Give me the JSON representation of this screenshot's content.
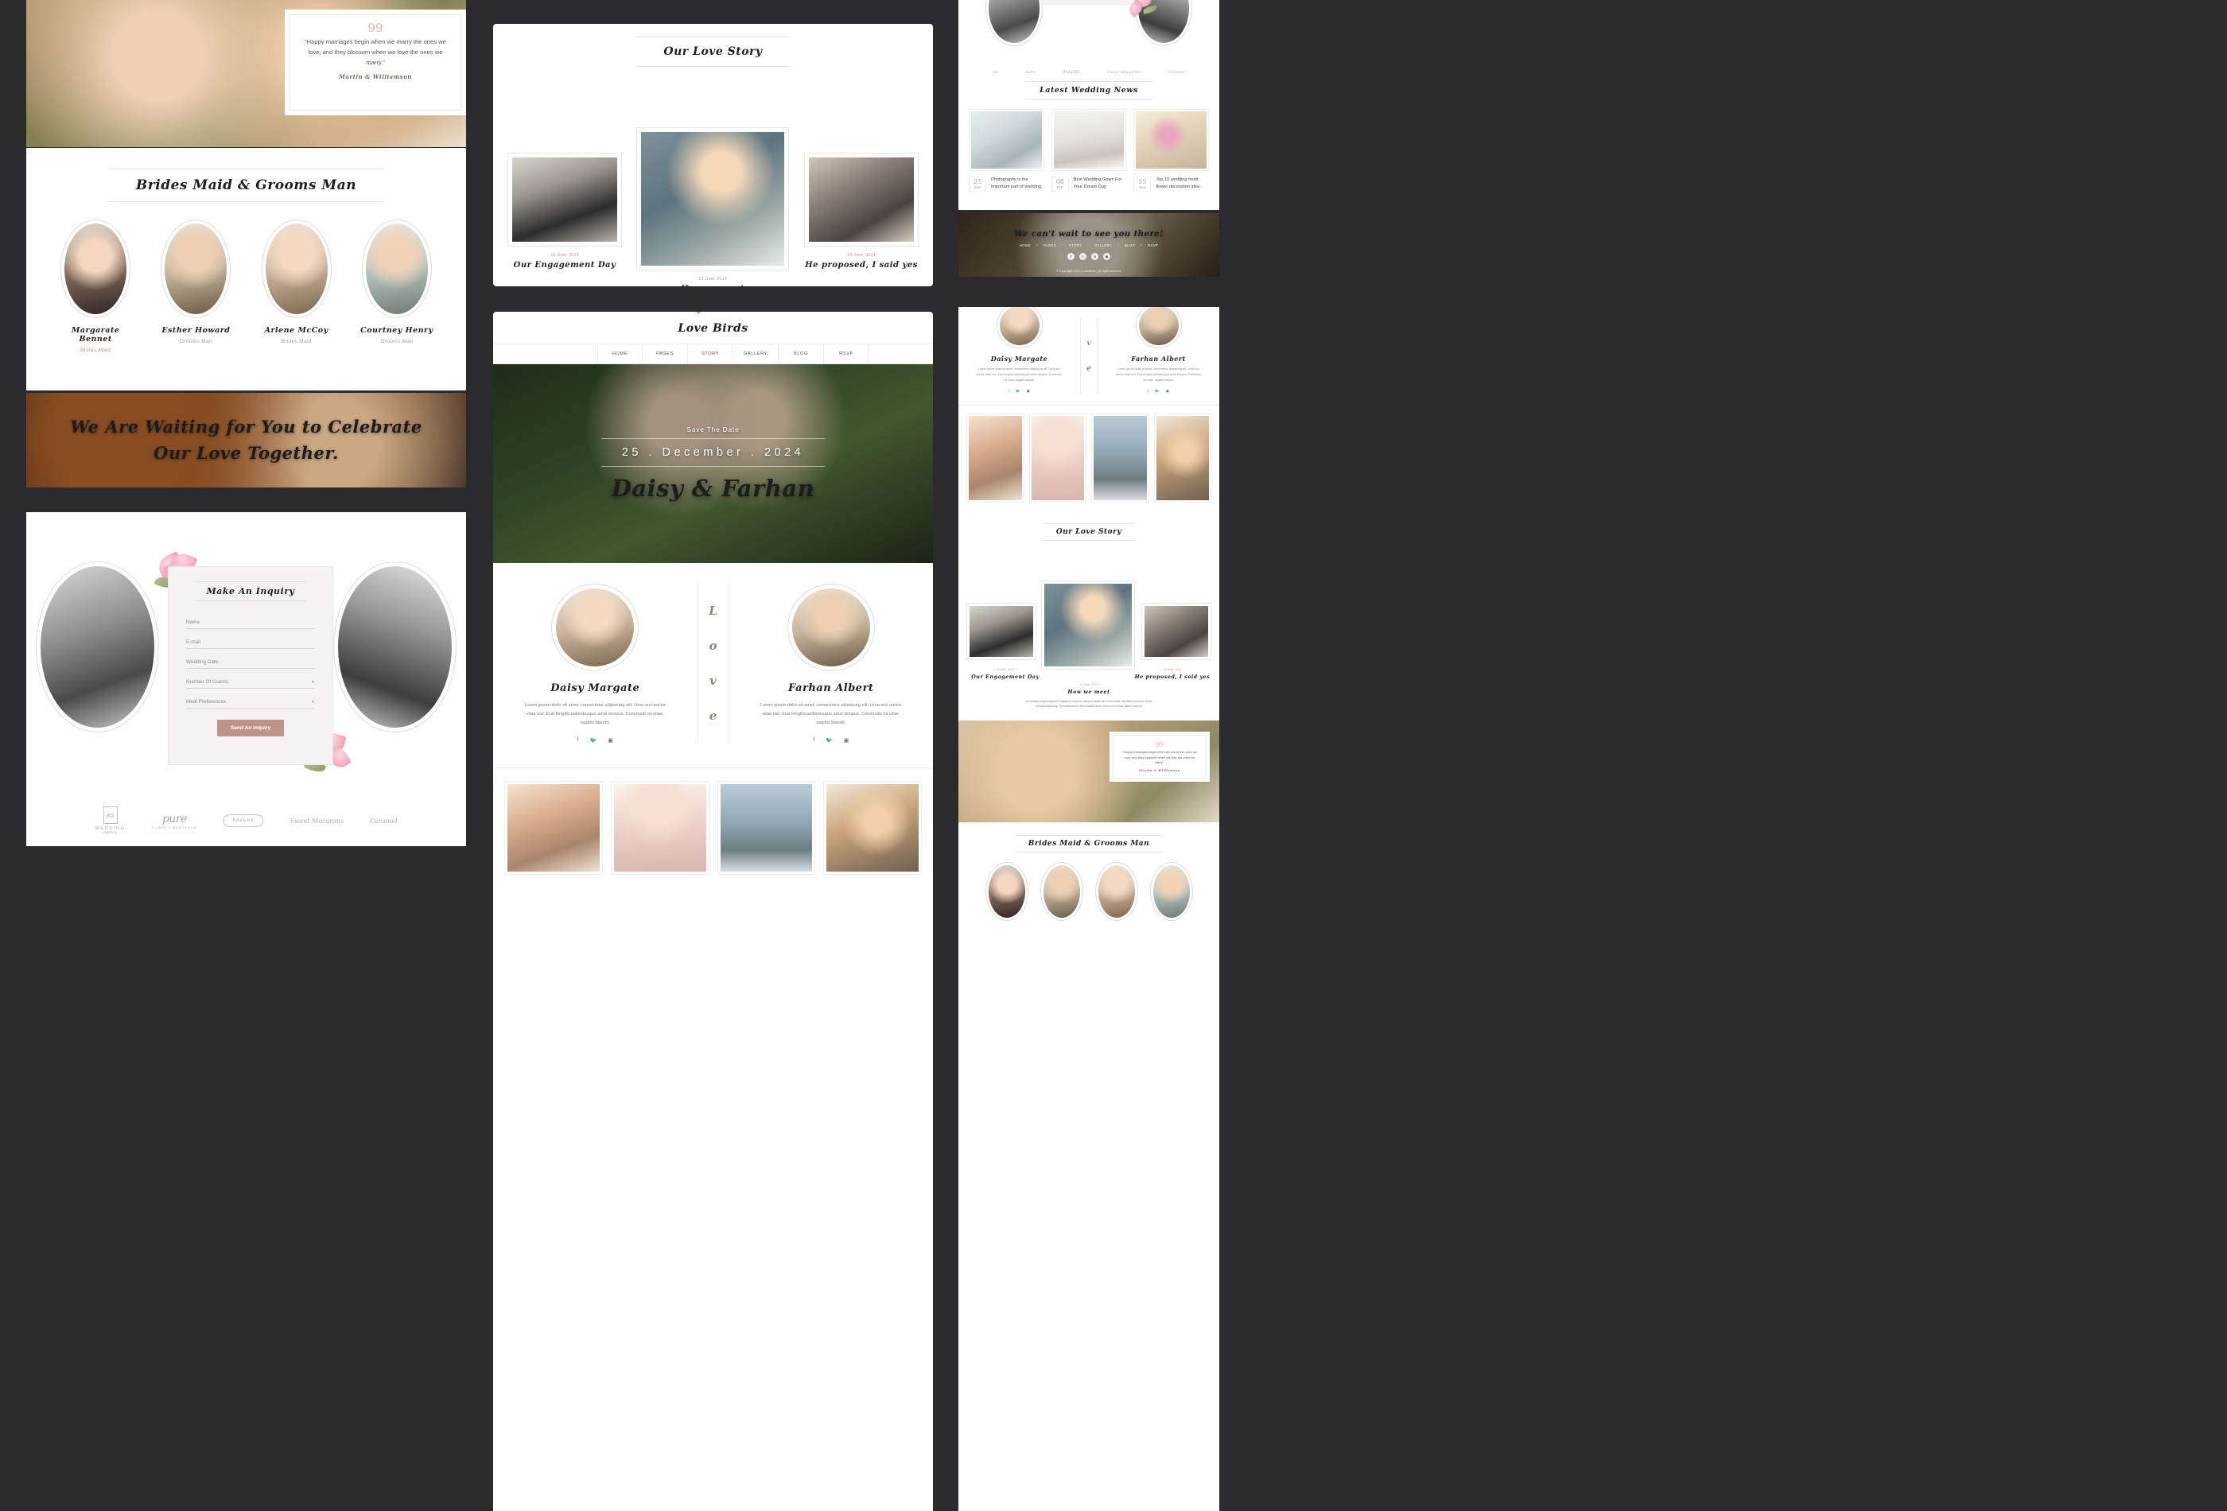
{
  "site": {
    "brand": "Love Birds",
    "nav": [
      "HOME",
      "PAGES",
      "STORY",
      "GALLERY",
      "BLOG",
      "RSVP"
    ],
    "hero": {
      "save_the_date": "Save The Date",
      "date": "25 . December . 2024",
      "names": "Daisy & Farhan"
    },
    "copyright": "© Copyright 2024 | LoveBirds | All right reserved.",
    "footer_heading": "We can't wait to see you there!"
  },
  "quote": {
    "mark": "99",
    "text": "“Happy marriages begin when we marry the ones we love, and they blossom when we love the ones we marry.”",
    "author": "Martin & Williamson"
  },
  "bridesmaid": {
    "title": "Brides Maid & Grooms Man",
    "members": [
      {
        "name": "Margarate Bennet",
        "role": "Brides Maid"
      },
      {
        "name": "Esther Howard",
        "role": "Grooms Man"
      },
      {
        "name": "Arlene McCoy",
        "role": "Brides Maid"
      },
      {
        "name": "Courtney Henry",
        "role": "Grooms Man"
      }
    ]
  },
  "cta": {
    "line1": "We Are Waiting for You to Celebrate",
    "line2": "Our Love Together."
  },
  "inquiry": {
    "title": "Make An Inquiry",
    "fields": [
      {
        "label": "Name",
        "type": "text"
      },
      {
        "label": "E-mail",
        "type": "text"
      },
      {
        "label": "Wedding Date",
        "type": "text"
      },
      {
        "label": "Number Of Guests",
        "type": "select"
      },
      {
        "label": "Meal Preferences",
        "type": "select"
      }
    ],
    "submit": "Send An Inquiry"
  },
  "brands": [
    {
      "mark": "jes",
      "name": "WEDDING",
      "sub": "agency"
    },
    {
      "mark": "pure",
      "name": "",
      "sub": "S JAMES  HANDMADE"
    },
    {
      "mark": "BAKERY",
      "name": "",
      "sub": ""
    },
    {
      "mark": "Sweet Macarons",
      "name": "",
      "sub": ""
    },
    {
      "mark": "Caramel",
      "name": "",
      "sub": ""
    }
  ],
  "story": {
    "title": "Our Love Story",
    "items": [
      {
        "date": "15 June, 2014",
        "heading": "Our Engagement Day"
      },
      {
        "date": "15 June, 2014",
        "heading": "How we meet"
      },
      {
        "date": "15 June, 2014",
        "heading": "He proposed, I said yes"
      }
    ],
    "body": "Consectetur adipiscing elit. Fringilla at risus orci, tempus facilisi sed. Enim tortor, faucibus netus orci donec volutpat adipiscing. Sit condimentum elit convallis libero. Nunc in eu tellus ipsum placerat."
  },
  "couple": {
    "bride": {
      "name": "Daisy Margate",
      "bio": "Lorem ipsum dolor sit amet, consectetur adipiscing elit. Urna orci auctor vitae nisl. Erat fringilla pellentesque amet tempus. Commodo mi vitae, sagittis blandit."
    },
    "groom": {
      "name": "Farhan Albert",
      "bio": "Lorem ipsum dolor sit amet, consectetur adipiscing elit. Urna orci auctor vitae nisl. Erat fringilla pellentesque amet tempus. Commodo mi vitae, sagittis blandit."
    },
    "divider_letters": [
      "L",
      "o",
      "v",
      "e"
    ]
  },
  "news": {
    "title": "Latest Wedding News",
    "posts": [
      {
        "day": "25",
        "month": "June",
        "title": "Photography is the important part of wedding."
      },
      {
        "day": "08",
        "month": "Feb",
        "title": "Best Wedding Gown For Your Dream Day"
      },
      {
        "day": "25",
        "month": "June",
        "title": "Top 10 wedding fresh flower decoration idea."
      }
    ]
  },
  "socials": [
    "f",
    "t",
    "in",
    "ig"
  ],
  "colors": {
    "accent_rose": "#c0928a",
    "accent_olive": "#8b8c77",
    "muted_pink": "#c29a92",
    "canvas": "#2b2b2e"
  }
}
